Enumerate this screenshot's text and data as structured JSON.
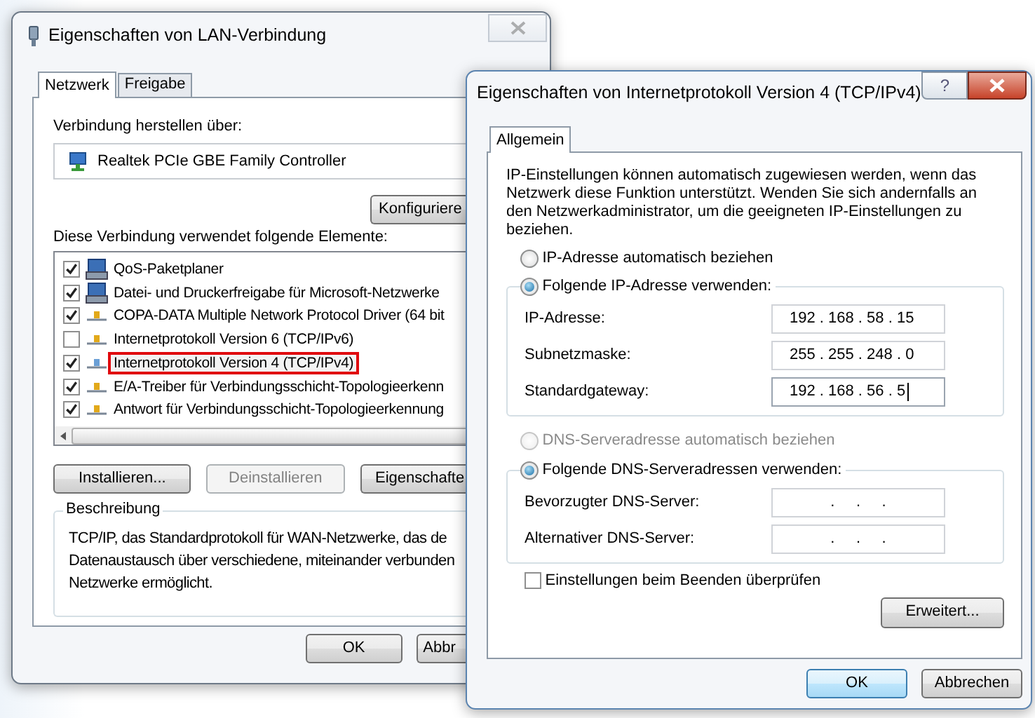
{
  "back_window": {
    "title": "Eigenschaften von LAN-Verbindung",
    "tabs": [
      {
        "label": "Netzwerk",
        "selected": true
      },
      {
        "label": "Freigabe",
        "selected": false
      }
    ],
    "connect_label": "Verbindung herstellen über:",
    "adapter": "Realtek PCIe GBE Family Controller",
    "configure_button": "Konfiguriere",
    "elements_label": "Diese Verbindung verwendet folgende Elemente:",
    "elements": [
      {
        "label": "QoS-Paketplaner",
        "checked": true,
        "kind": "client",
        "highlighted": false
      },
      {
        "label": "Datei- und Druckerfreigabe für Microsoft-Netzwerke",
        "checked": true,
        "kind": "client",
        "highlighted": false
      },
      {
        "label": "COPA-DATA Multiple Network Protocol Driver (64 bit",
        "checked": true,
        "kind": "protocol",
        "highlighted": false
      },
      {
        "label": "Internetprotokoll Version 6 (TCP/IPv6)",
        "checked": false,
        "kind": "protocol",
        "highlighted": false
      },
      {
        "label": "Internetprotokoll Version 4 (TCP/IPv4)",
        "checked": true,
        "kind": "protocol",
        "highlighted": true
      },
      {
        "label": "E/A-Treiber für Verbindungsschicht-Topologieerkenn",
        "checked": true,
        "kind": "protocol",
        "highlighted": false
      },
      {
        "label": "Antwort für Verbindungsschicht-Topologieerkennung",
        "checked": true,
        "kind": "protocol",
        "highlighted": false
      }
    ],
    "buttons": [
      {
        "label": "Installieren...",
        "disabled": false
      },
      {
        "label": "Deinstallieren",
        "disabled": true
      },
      {
        "label": "Eigenschafte",
        "disabled": false
      }
    ],
    "description": {
      "legend": "Beschreibung",
      "lines": [
        "TCP/IP, das Standardprotokoll für WAN-Netzwerke, das de",
        "Datenaustausch über verschiedene, miteinander verbunden",
        "Netzwerke ermöglicht."
      ]
    },
    "footer_buttons": [
      "OK",
      "Abbr"
    ]
  },
  "front_window": {
    "title": "Eigenschaften von Internetprotokoll Version 4 (TCP/IPv4)",
    "help_button": "?",
    "tabs": [
      {
        "label": "Allgemein",
        "selected": true
      }
    ],
    "intro": "IP-Einstellungen können automatisch zugewiesen werden, wenn das Netzwerk diese Funktion unterstützt. Wenden Sie sich andernfalls an den Netzwerkadministrator, um die geeigneten IP-Einstellungen zu beziehen.",
    "ip_radios": [
      {
        "label": "IP-Adresse automatisch beziehen",
        "selected": false,
        "disabled": false
      },
      {
        "label": "Folgende IP-Adresse verwenden:",
        "selected": true,
        "disabled": false
      }
    ],
    "ip_fields": [
      {
        "label": "IP-Adresse:",
        "value": "192 . 168 . 58 . 15",
        "focused": false
      },
      {
        "label": "Subnetzmaske:",
        "value": "255 . 255 . 248 . 0",
        "focused": false
      },
      {
        "label": "Standardgateway:",
        "value": "192 . 168 . 56 . 5",
        "focused": true
      }
    ],
    "dns_radios": [
      {
        "label": "DNS-Serveradresse automatisch beziehen",
        "selected": false,
        "disabled": true
      },
      {
        "label": "Folgende DNS-Serveradressen verwenden:",
        "selected": true,
        "disabled": false
      }
    ],
    "dns_fields": [
      {
        "label": "Bevorzugter DNS-Server:",
        "value": ".     .     .",
        "focused": false
      },
      {
        "label": "Alternativer DNS-Server:",
        "value": ".     .     .",
        "focused": false
      }
    ],
    "validate_checkbox": {
      "label": "Einstellungen beim Beenden überprüfen",
      "checked": false
    },
    "advanced_button": "Erweitert...",
    "footer_buttons": [
      "OK",
      "Abbrechen"
    ]
  }
}
